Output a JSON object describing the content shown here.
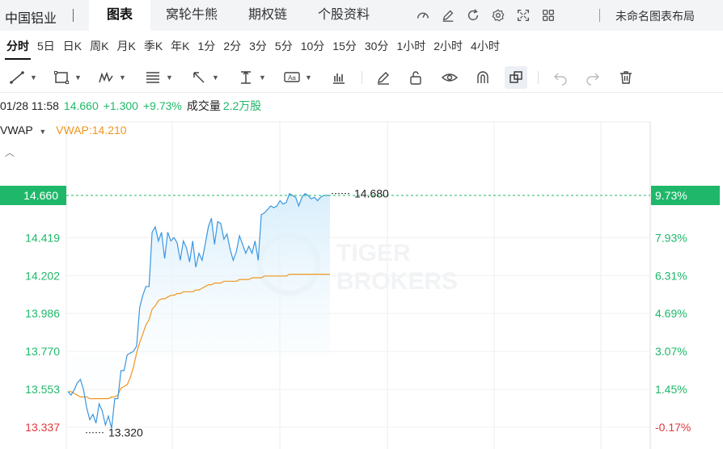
{
  "header": {
    "stock_name": "中国铝业",
    "tabs": [
      "图表",
      "窝轮牛熊",
      "期权链",
      "个股资料"
    ],
    "active_tab": "图表",
    "icons": [
      "speedometer-icon",
      "edit-icon",
      "refresh-icon",
      "settings-icon",
      "fullscreen-icon",
      "grid-icon"
    ],
    "layout_label": "未命名图表布局"
  },
  "periods": {
    "items": [
      "分时",
      "5日",
      "日K",
      "周K",
      "月K",
      "季K",
      "年K",
      "1分",
      "2分",
      "3分",
      "5分",
      "10分",
      "15分",
      "30分",
      "1小时",
      "2小时",
      "4小时"
    ],
    "active": "分时"
  },
  "toolbar": {
    "tools": [
      "line-tool-icon",
      "rectangle-tool-icon",
      "pattern-tool-icon",
      "fib-tool-icon",
      "arrow-tool-icon",
      "measure-tool-icon",
      "text-tool-icon",
      "indicator-icon",
      "brush-icon",
      "lock-icon",
      "eye-icon",
      "magnet-icon",
      "copy-icon",
      "undo-icon",
      "redo-icon",
      "delete-icon"
    ]
  },
  "quote": {
    "datetime": "01/28 11:58",
    "price": "14.660",
    "change": "+1.300",
    "change_pct": "+9.73%",
    "volume_label": "成交量",
    "volume": "2.2万股"
  },
  "indicator": {
    "name": "VWAP",
    "value_label": "VWAP:14.210"
  },
  "colors": {
    "up": "#1fb86a",
    "down": "#e0383e",
    "price_line": "#3b96df",
    "vwap_line": "#f0961e",
    "area_fill": "#d8eefb",
    "current_tag_bg": "#1fb86a"
  },
  "watermark": [
    "TIGER",
    "BROKERS"
  ],
  "chart_data": {
    "type": "line",
    "y_ticks_left": [
      "14.660",
      "14.419",
      "14.202",
      "13.986",
      "13.770",
      "13.553",
      "13.337"
    ],
    "y_ticks_right": [
      "9.73%",
      "7.93%",
      "6.31%",
      "4.69%",
      "3.07%",
      "1.45%",
      "-0.17%"
    ],
    "ylim": [
      13.337,
      14.66
    ],
    "current_price": 14.66,
    "high_label": "14.680",
    "high_value": 14.68,
    "low_label": "13.320",
    "low_value": 13.32,
    "series": [
      {
        "name": "price",
        "values": [
          13.54,
          13.52,
          13.55,
          13.59,
          13.61,
          13.55,
          13.45,
          13.38,
          13.41,
          13.36,
          13.47,
          13.43,
          13.35,
          13.4,
          13.33,
          13.5,
          13.5,
          13.66,
          13.66,
          13.75,
          13.76,
          13.77,
          13.8,
          14.02,
          14.09,
          14.14,
          14.14,
          14.45,
          14.48,
          14.4,
          14.45,
          14.3,
          14.45,
          14.4,
          14.42,
          14.39,
          14.29,
          14.4,
          14.36,
          14.28,
          14.4,
          14.25,
          14.33,
          14.29,
          14.38,
          14.48,
          14.53,
          14.38,
          14.51,
          14.5,
          14.41,
          14.44,
          14.35,
          14.29,
          14.34,
          14.43,
          14.38,
          14.33,
          14.37,
          14.33,
          14.4,
          14.29,
          14.55,
          14.56,
          14.58,
          14.6,
          14.59,
          14.6,
          14.63,
          14.61,
          14.62,
          14.67,
          14.66,
          14.65,
          14.6,
          14.65,
          14.67,
          14.66,
          14.64,
          14.65,
          14.63,
          14.65,
          14.66,
          14.66,
          14.66
        ]
      },
      {
        "name": "VWAP",
        "values": [
          13.54,
          13.54,
          13.53,
          13.52,
          13.51,
          13.51,
          13.51,
          13.5,
          13.5,
          13.5,
          13.5,
          13.5,
          13.5,
          13.5,
          13.51,
          13.51,
          13.52,
          13.56,
          13.57,
          13.58,
          13.62,
          13.68,
          13.76,
          13.82,
          13.87,
          13.92,
          13.95,
          14.01,
          14.03,
          14.06,
          14.07,
          14.07,
          14.08,
          14.09,
          14.09,
          14.1,
          14.1,
          14.11,
          14.11,
          14.11,
          14.11,
          14.12,
          14.12,
          14.13,
          14.14,
          14.15,
          14.15,
          14.16,
          14.16,
          14.16,
          14.17,
          14.17,
          14.17,
          14.17,
          14.17,
          14.18,
          14.18,
          14.18,
          14.18,
          14.19,
          14.19,
          14.19,
          14.19,
          14.2,
          14.2,
          14.2,
          14.2,
          14.2,
          14.2,
          14.2,
          14.2,
          14.21,
          14.21,
          14.21,
          14.21,
          14.21,
          14.21,
          14.21,
          14.21,
          14.21,
          14.21,
          14.21,
          14.21,
          14.21,
          14.21
        ]
      }
    ],
    "grid": true
  }
}
